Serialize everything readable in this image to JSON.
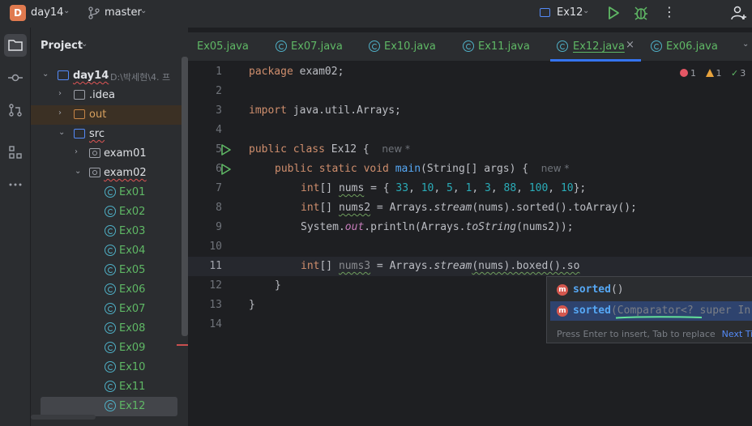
{
  "titlebar": {
    "project_badge": "D",
    "project_name": "day14",
    "branch": "master",
    "run_config": "Ex12"
  },
  "toolstrip": {
    "icons": [
      "project-folder-icon",
      "commit-icon",
      "pull-requests-icon",
      "structure-icon",
      "more-tools-icon"
    ]
  },
  "project_panel": {
    "title": "Project",
    "root": {
      "name": "day14",
      "path": "D:\\박세현\\4. 프"
    },
    "items": [
      {
        "label": ".idea"
      },
      {
        "label": "out"
      },
      {
        "label": "src"
      },
      {
        "label": "exam01"
      },
      {
        "label": "exam02"
      },
      {
        "label": "Ex01"
      },
      {
        "label": "Ex02"
      },
      {
        "label": "Ex03"
      },
      {
        "label": "Ex04"
      },
      {
        "label": "Ex05"
      },
      {
        "label": "Ex06"
      },
      {
        "label": "Ex07"
      },
      {
        "label": "Ex08"
      },
      {
        "label": "Ex09"
      },
      {
        "label": "Ex10"
      },
      {
        "label": "Ex11"
      },
      {
        "label": "Ex12"
      }
    ]
  },
  "tabs": [
    {
      "label": "Ex05.java"
    },
    {
      "label": "Ex07.java"
    },
    {
      "label": "Ex10.java"
    },
    {
      "label": "Ex11.java"
    },
    {
      "label": "Ex12.java",
      "close": "×"
    },
    {
      "label": "Ex06.java"
    }
  ],
  "inspections": {
    "errors": "1",
    "warnings": "1",
    "ok": "3"
  },
  "editor": {
    "line_numbers": [
      "1",
      "2",
      "3",
      "4",
      "5",
      "6",
      "7",
      "8",
      "9",
      "10",
      "11",
      "12",
      "13",
      "14"
    ],
    "code": {
      "l1_kw": "package",
      "l1_rest": " exam02;",
      "l3_kw": "import",
      "l3_rest": " java.util.Arrays;",
      "l5_kw": "public class",
      "l5_rest": " Ex12 {",
      "l5_hint": "new *",
      "l6_kw": "public static void",
      "l6_fn": "main",
      "l6_rest": "(String[] args) {",
      "l6_hint": "new *",
      "l7_a": "int",
      "l7_b": "[] ",
      "l7_var": "nums",
      "l7_c": " = { ",
      "l7_n1": "33",
      "l7_n2": "10",
      "l7_n3": "5",
      "l7_n4": "1",
      "l7_n5": "3",
      "l7_n6": "88",
      "l7_n7": "100",
      "l7_n8": "10",
      "l7_end": "};",
      "l8_a": "int",
      "l8_b": "[] ",
      "l8_var": "nums2",
      "l8_c": " = Arrays.",
      "l8_stream": "stream",
      "l8_d": "(nums).sorted().toArray();",
      "l9_a": "System.",
      "l9_out": "out",
      "l9_b": ".println(Arrays.",
      "l9_ts": "toString",
      "l9_c": "(nums2));",
      "l11_a": "int",
      "l11_b": "[] ",
      "l11_var": "nums3",
      "l11_c": " = Arrays.",
      "l11_stream": "stream",
      "l11_d": "(nums).boxed().so",
      "l12": "}",
      "l13": "}"
    }
  },
  "completion": {
    "items": [
      {
        "icon": "m",
        "name": "sorted",
        "params": "()"
      },
      {
        "icon": "m",
        "name": "sorted",
        "params": "(Comparator<? super In"
      }
    ],
    "footer": "Press Enter to insert, Tab to replace",
    "next_tip": "Next Tip"
  },
  "colors": {
    "accent": "#3574f0",
    "class_green": "#5fb865",
    "keyword": "#cf8e6d",
    "number": "#2aacb8",
    "method": "#56a8f5"
  }
}
